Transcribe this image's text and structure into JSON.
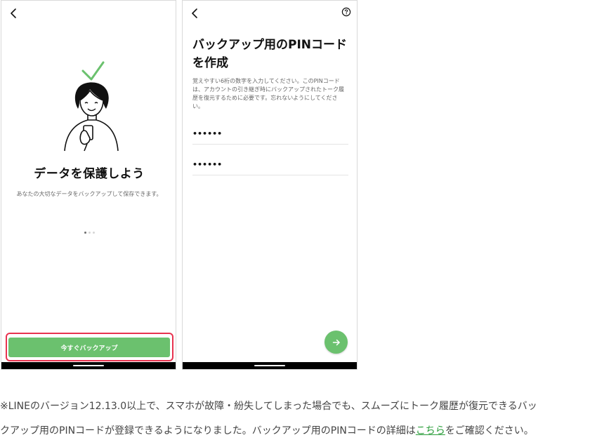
{
  "colors": {
    "accent_green": "#6bc16e",
    "highlight_red": "#e8334f",
    "link_green": "#2a9d3a",
    "text_dark": "#111111",
    "text_muted": "#666666"
  },
  "screen1": {
    "back_icon": "chevron-left-icon",
    "illustration": "woman-holding-phone-with-checkmark",
    "title": "データを保護しよう",
    "description": "あなたの大切なデータをバックアップして保存できます。",
    "pager": {
      "total": 3,
      "active": 1
    },
    "cta_button": "今すぐバックアップ"
  },
  "screen2": {
    "back_icon": "chevron-left-icon",
    "help_icon": "question-circle-icon",
    "title": "バックアップ用のPINコードを作成",
    "description": "覚えやすい6桁の数字を入力してください。このPINコードは、アカウントの引き継ぎ時にバックアップされたトーク履歴を復元するために必要です。忘れないようにしてください。",
    "pin_input_1": "••••••",
    "pin_input_2": "••••••",
    "next_icon": "arrow-right-icon"
  },
  "caption": {
    "line1": "※LINEのバージョン12.13.0以上で、スマホが故障・紛失してしまった場合でも、スムーズにトーク履歴が復元できるバッ",
    "line2_before": "クアップ用のPINコードが登録できるようになりました。バックアップ用のPINコードの詳細は",
    "link": "こちら",
    "line2_after": "をご確認ください。"
  }
}
